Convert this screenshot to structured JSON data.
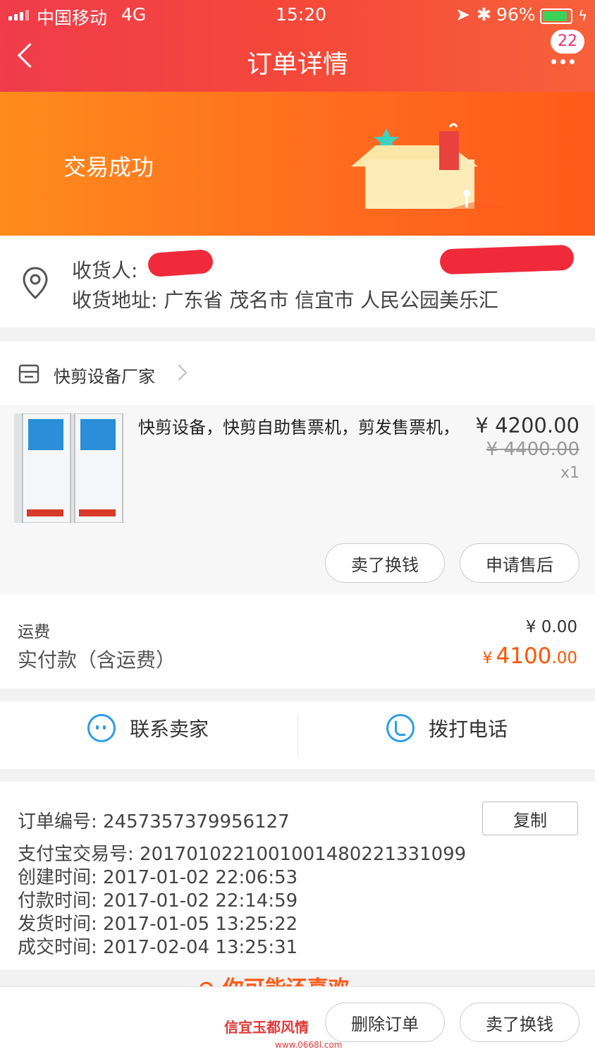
{
  "status_bar": {
    "carrier": "中国移动",
    "network": "4G",
    "time": "15:20",
    "battery": "96%"
  },
  "nav": {
    "title": "订单详情",
    "badge_count": "22"
  },
  "banner": {
    "status_text": "交易成功"
  },
  "address": {
    "receiver_label": "收货人:",
    "address_label": "收货地址:",
    "address_value": "广东省 茂名市 信宜市 人民公园美乐汇"
  },
  "store": {
    "name": "快剪设备厂家"
  },
  "product": {
    "title": "快剪设备，快剪自助售票机，剪发售票机，",
    "price": "¥ 4200.00",
    "original_price": "¥ 4400.00",
    "quantity": "x1"
  },
  "item_actions": {
    "sell_label": "卖了换钱",
    "after_sale_label": "申请售后"
  },
  "payment": {
    "freight_label": "运费",
    "freight_value": "¥ 0.00",
    "paid_label": "实付款（含运费）",
    "paid_currency": "¥",
    "paid_main": "4100",
    "paid_decimal": ".00"
  },
  "contact": {
    "seller_label": "联系卖家",
    "phone_label": "拨打电话"
  },
  "order_info": {
    "copy_label": "复制",
    "rows": [
      {
        "label": "订单编号:",
        "value": "2457357379956127"
      },
      {
        "label": "支付宝交易号:",
        "value": "2017010221001001480221331099"
      },
      {
        "label": "创建时间:",
        "value": "2017-01-02 22:06:53"
      },
      {
        "label": "付款时间:",
        "value": "2017-01-02 22:14:59"
      },
      {
        "label": "发货时间:",
        "value": "2017-01-05 13:25:22"
      },
      {
        "label": "成交时间:",
        "value": "2017-02-04 13:25:31"
      }
    ]
  },
  "recommend": {
    "text": "你可能还喜欢"
  },
  "footer": {
    "delete_label": "删除订单",
    "sell_label": "卖了换钱"
  },
  "watermark": {
    "text": "信宜玉都风情",
    "url": "www.0668l.com"
  },
  "colors": {
    "header": "#f03c4b",
    "banner": "#ff7a1c",
    "price_accent": "#ff5500",
    "icon_blue": "#2d9ee8"
  }
}
